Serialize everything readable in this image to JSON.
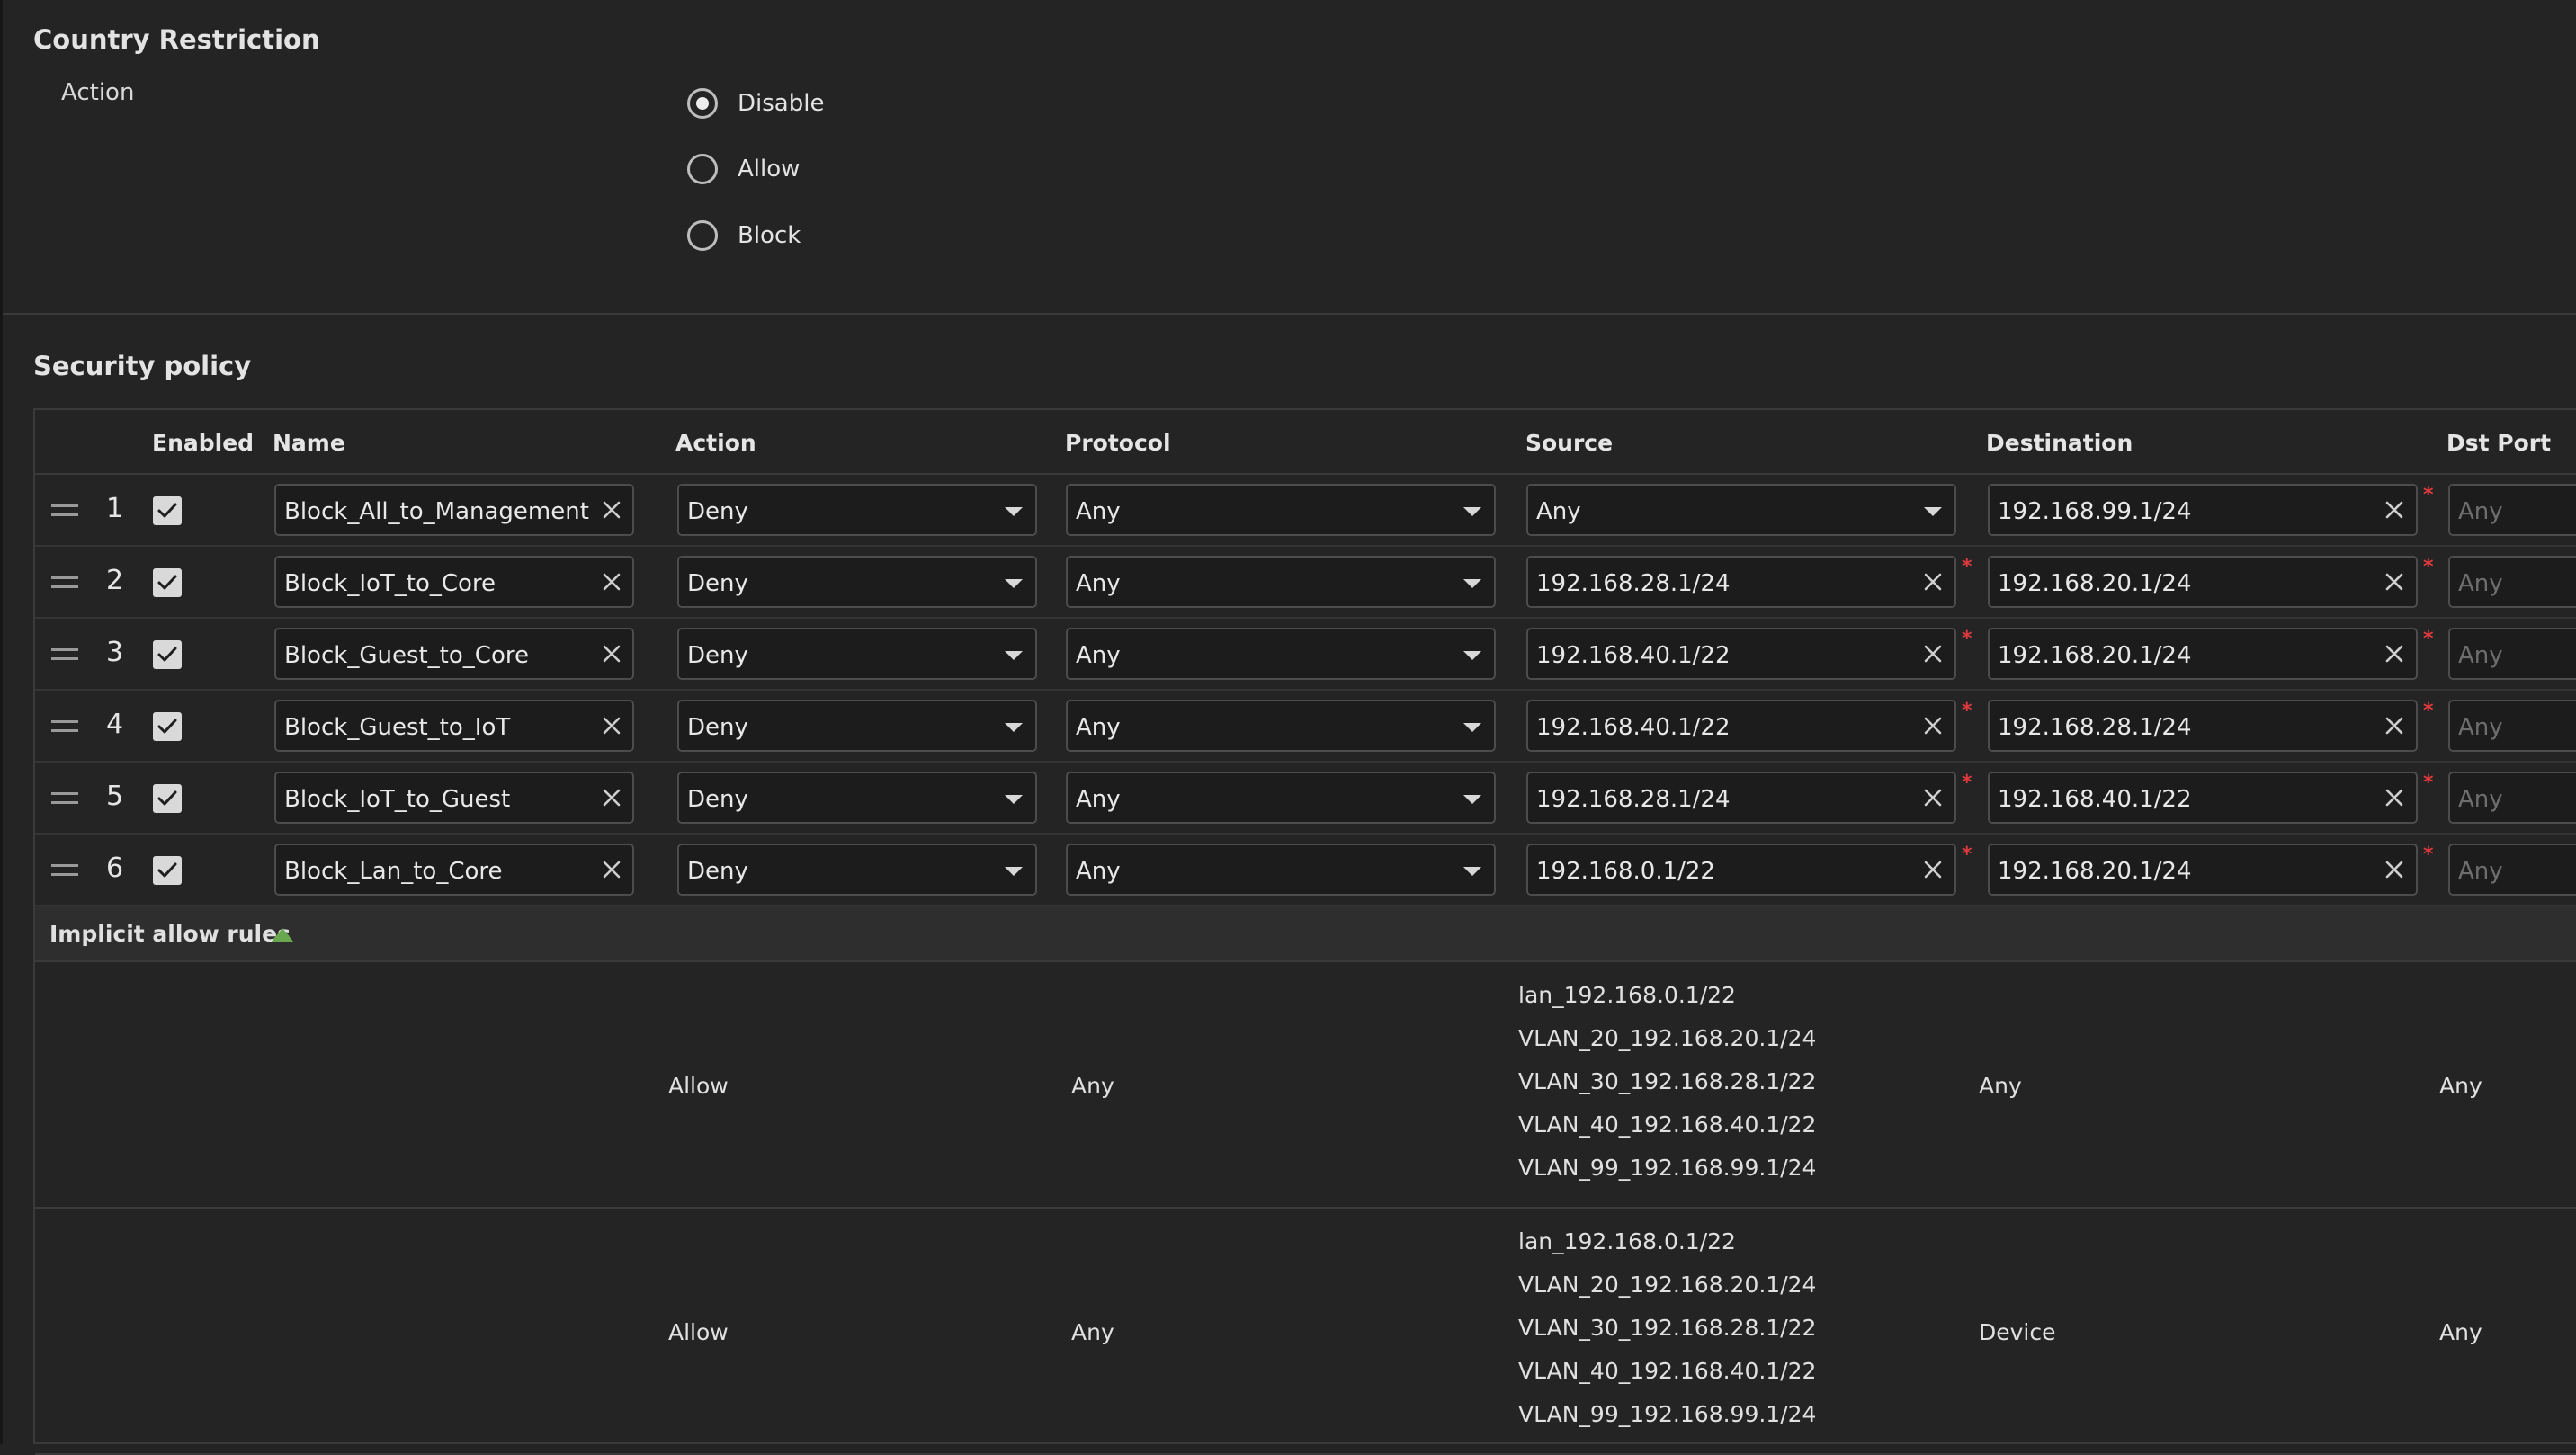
{
  "country_restriction": {
    "title": "Country Restriction",
    "action_label": "Action",
    "options": [
      "Disable",
      "Allow",
      "Block"
    ],
    "selected": "Disable"
  },
  "security_policy": {
    "title": "Security policy",
    "headers": {
      "enabled": "Enabled",
      "name": "Name",
      "action": "Action",
      "protocol": "Protocol",
      "source": "Source",
      "destination": "Destination",
      "dst_port": "Dst Port"
    },
    "rules": [
      {
        "index": "1",
        "enabled": true,
        "name": "Block_All_to_Management",
        "action": "Deny",
        "protocol": "Any",
        "source": "Any",
        "source_is_dropdown": true,
        "destination": "192.168.99.1/24",
        "dst_port": "Any"
      },
      {
        "index": "2",
        "enabled": true,
        "name": "Block_IoT_to_Core",
        "action": "Deny",
        "protocol": "Any",
        "source": "192.168.28.1/24",
        "source_is_dropdown": false,
        "destination": "192.168.20.1/24",
        "dst_port": "Any"
      },
      {
        "index": "3",
        "enabled": true,
        "name": "Block_Guest_to_Core",
        "action": "Deny",
        "protocol": "Any",
        "source": "192.168.40.1/22",
        "source_is_dropdown": false,
        "destination": "192.168.20.1/24",
        "dst_port": "Any"
      },
      {
        "index": "4",
        "enabled": true,
        "name": "Block_Guest_to_IoT",
        "action": "Deny",
        "protocol": "Any",
        "source": "192.168.40.1/22",
        "source_is_dropdown": false,
        "destination": "192.168.28.1/24",
        "dst_port": "Any"
      },
      {
        "index": "5",
        "enabled": true,
        "name": "Block_IoT_to_Guest",
        "action": "Deny",
        "protocol": "Any",
        "source": "192.168.28.1/24",
        "source_is_dropdown": false,
        "destination": "192.168.40.1/22",
        "dst_port": "Any"
      },
      {
        "index": "6",
        "enabled": true,
        "name": "Block_Lan_to_Core",
        "action": "Deny",
        "protocol": "Any",
        "source": "192.168.0.1/22",
        "source_is_dropdown": false,
        "destination": "192.168.20.1/24",
        "dst_port": "Any"
      }
    ],
    "implicit_label": "Implicit allow rules",
    "implicit_rules": [
      {
        "action": "Allow",
        "protocol": "Any",
        "sources": [
          "lan_192.168.0.1/22",
          "VLAN_20_192.168.20.1/24",
          "VLAN_30_192.168.28.1/22",
          "VLAN_40_192.168.40.1/22",
          "VLAN_99_192.168.99.1/24"
        ],
        "destination": "Any",
        "dst_port": "Any"
      },
      {
        "action": "Allow",
        "protocol": "Any",
        "sources": [
          "lan_192.168.0.1/22",
          "VLAN_20_192.168.20.1/24",
          "VLAN_30_192.168.28.1/22",
          "VLAN_40_192.168.40.1/22",
          "VLAN_99_192.168.99.1/24"
        ],
        "destination": "Device",
        "dst_port": "Any"
      }
    ]
  },
  "colors": {
    "background": "#242424",
    "required_marker": "#e0393e",
    "expand_arrow": "#6aa84f"
  }
}
